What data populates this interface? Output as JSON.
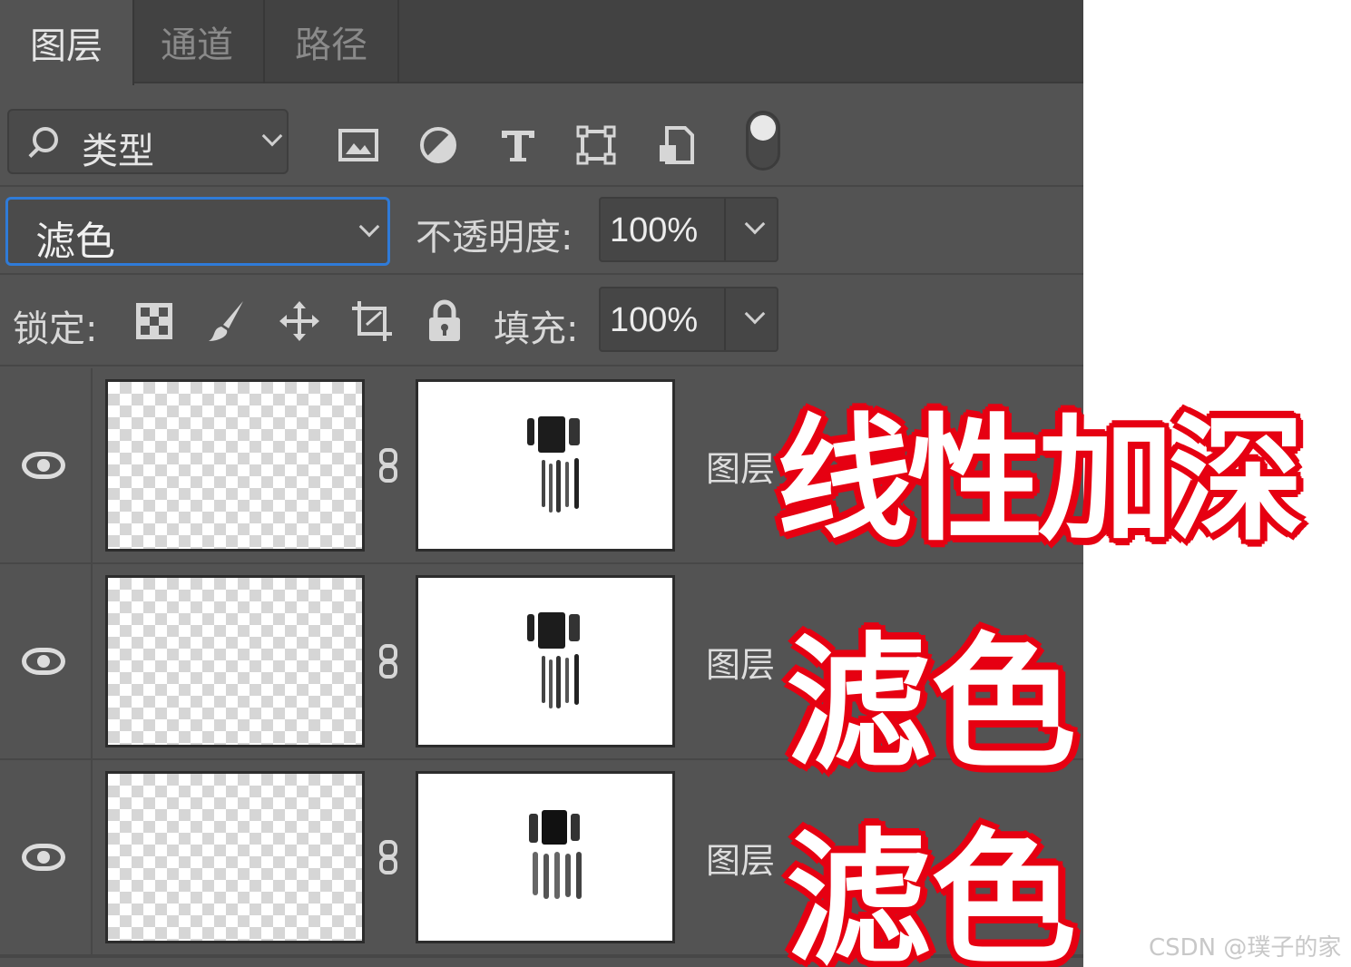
{
  "tabs": [
    {
      "label": "图层",
      "active": true
    },
    {
      "label": "通道",
      "active": false
    },
    {
      "label": "路径",
      "active": false
    }
  ],
  "filter": {
    "kind_label": "类型",
    "icons": [
      "image-filter-icon",
      "adjustment-filter-icon",
      "type-filter-icon",
      "shape-filter-icon",
      "smart-object-filter-icon"
    ]
  },
  "blend": {
    "mode": "滤色",
    "opacity_label": "不透明度:",
    "opacity_value": "100%"
  },
  "lock": {
    "label": "锁定:",
    "fill_label": "填充:",
    "fill_value": "100%"
  },
  "layers": [
    {
      "name": "图层",
      "visible": true
    },
    {
      "name": "图层",
      "visible": true
    },
    {
      "name": "图层",
      "visible": true
    }
  ],
  "annotations": {
    "a1": "线性加深",
    "a2": "滤色",
    "a3": "滤色"
  },
  "watermark": "CSDN @璞子的家",
  "colors": {
    "panel": "#535353",
    "selection_border": "#2f7bd8",
    "annotation_outline": "#e60012"
  }
}
